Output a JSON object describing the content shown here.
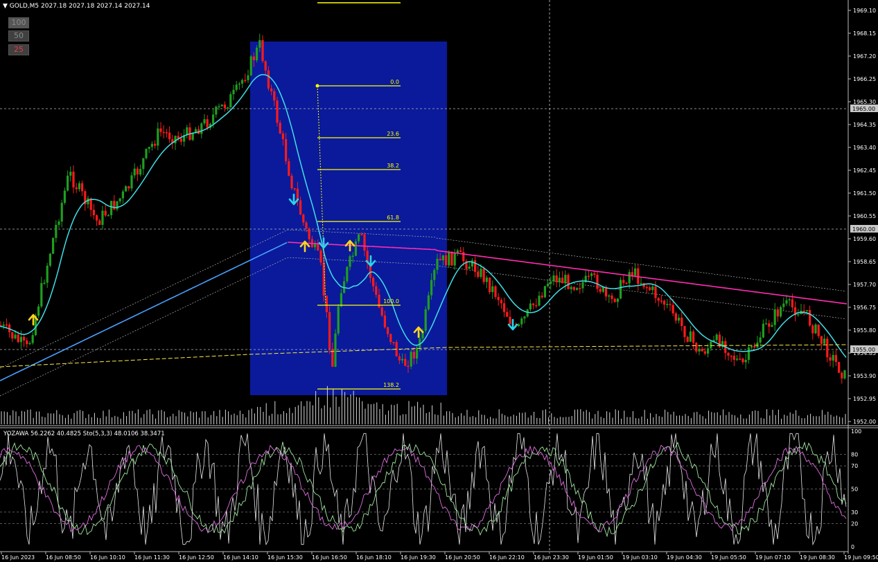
{
  "header": {
    "symbol": "GOLD,M5",
    "quote": "2027.18 2027.18 2027.14 2027.14"
  },
  "level_buttons": [
    {
      "label": "100",
      "color": "#8c8c8c",
      "bg": "#555555"
    },
    {
      "label": "50",
      "color": "#8c8c8c",
      "bg": "#404040"
    },
    {
      "label": "25",
      "color": "#e04040",
      "bg": "#404040"
    }
  ],
  "price_axis": {
    "ticks": [
      "1969.10",
      "1968.15",
      "1967.20",
      "1966.25",
      "1965.30",
      "1964.35",
      "1963.40",
      "1962.45",
      "1961.50",
      "1960.55",
      "1959.60",
      "1958.65",
      "1957.70",
      "1956.75",
      "1955.80",
      "1954.85",
      "1953.90",
      "1952.95",
      "1952.00"
    ],
    "boxed_levels": [
      "1965.00",
      "1960.00",
      "1955.00"
    ]
  },
  "indicator": {
    "label": "YOZAWA 56.2262 40.4825  Sto(5,3,3) 48.0106 38.3471",
    "ticks": [
      "100",
      "80",
      "70",
      "50",
      "30",
      "20",
      "0"
    ]
  },
  "fib_levels": [
    "0.0",
    "23.6",
    "38.2",
    "61.8",
    "100.0",
    "138.2"
  ],
  "time_axis": [
    "16 Jun 2023",
    "16 Jun 08:50",
    "16 Jun 10:10",
    "16 Jun 11:30",
    "16 Jun 12:50",
    "16 Jun 14:10",
    "16 Jun 15:30",
    "16 Jun 16:50",
    "16 Jun 18:10",
    "16 Jun 19:30",
    "16 Jun 20:50",
    "16 Jun 22:10",
    "16 Jun 23:30",
    "19 Jun 01:50",
    "19 Jun 03:10",
    "19 Jun 04:30",
    "19 Jun 05:50",
    "19 Jun 07:10",
    "19 Jun 08:30",
    "19 Jun 09:50"
  ],
  "colors": {
    "bull": "#1f9e1f",
    "bear": "#ff1a1a",
    "ma_fast": "#40e0e8",
    "ma_slow": "#4aa0ff",
    "ma_pink": "#ff2db0",
    "fib": "#ffff00",
    "highlight": "#0a1a9a",
    "arrow_up": "#ffd21e",
    "arrow_down": "#2ad4e8"
  }
}
